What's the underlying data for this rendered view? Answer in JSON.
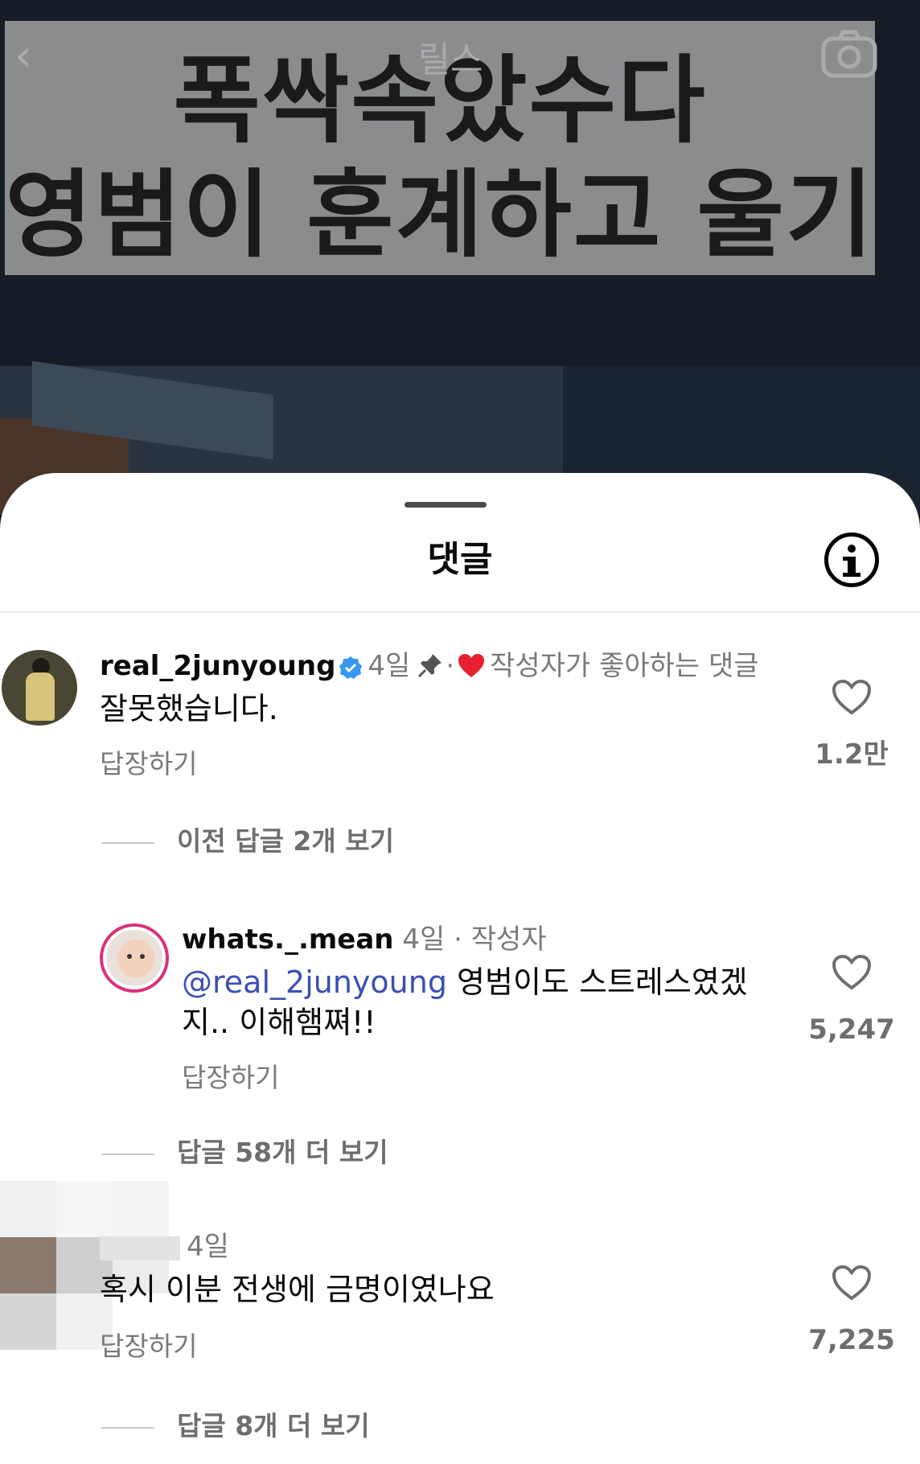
{
  "reel": {
    "back_glyph": "‹",
    "title": "릴스",
    "caption_line1": "폭싹속았수다",
    "caption_line2": "영범이 훈계하고 울기"
  },
  "sheet": {
    "title": "댓글"
  },
  "comments": [
    {
      "username": "real_2junyoung",
      "verified": true,
      "time": "4일",
      "separator": "·",
      "creator_liked_label": "작성자가 좋아하는 댓글",
      "text": "잘못했습니다.",
      "reply_label": "답장하기",
      "likes": "1.2만",
      "thread_label": "이전 답글 2개 보기"
    },
    {
      "username": "whats._.mean",
      "time": "4일",
      "separator": "·",
      "author_badge": "작성자",
      "mention": "@real_2junyoung",
      "text_after_mention": " 영범이도 스트레스였겠",
      "text_line2": "지.. 이해햄쪄!!",
      "reply_label": "답장하기",
      "likes": "5,247",
      "thread_label": "답글 58개 더 보기"
    },
    {
      "username": "",
      "time": "4일",
      "text": "혹시 이분 전생에 금명이였나요",
      "reply_label": "답장하기",
      "likes": "7,225",
      "thread_label": "답글 8개 더 보기"
    }
  ],
  "colors": {
    "mention": "#3b4fb5",
    "verified": "#3897f0",
    "heart_red": "#e8202f",
    "muted": "#7a7a7a"
  }
}
